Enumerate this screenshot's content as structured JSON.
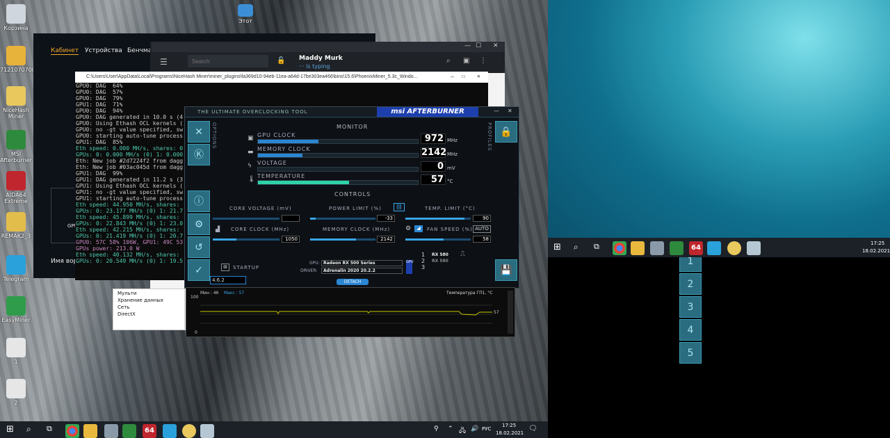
{
  "desktop": {
    "icons": [
      {
        "label": "Корзина",
        "color": "#cfd6dd"
      },
      {
        "label": "7121070700",
        "color": "#e8b33a"
      },
      {
        "label": "NiceHash Miner",
        "color": "#e9c95e"
      },
      {
        "label": "MSI Afterburner",
        "color": "#2e8a3c"
      },
      {
        "label": "AIDA64 Extreme",
        "color": "#c0262d"
      },
      {
        "label": "REMAK2_3",
        "color": "#e3bd4c"
      },
      {
        "label": "Telegram",
        "color": "#2aa1da"
      },
      {
        "label": "EasyMiner",
        "color": "#2f9c4b"
      },
      {
        "label": "1",
        "color": "#e6e6e6"
      },
      {
        "label": "2",
        "color": "#e6e6e6"
      }
    ],
    "this_pc": "Этот"
  },
  "nicehash": {
    "tabs": [
      "Кабинет",
      "Устройства",
      "Бенчмарк"
    ],
    "gpu_label": "GPU",
    "name_label": "Имя вор"
  },
  "telegram": {
    "search_placeholder": "Search",
    "contact": "Maddy Murk",
    "status": "··· is typing"
  },
  "cmd": {
    "title": "C:\\Users\\User\\AppData\\Local\\Programs\\NiceHash Miner\\miner_plugins\\fa369d10-94eb-11ea-a64d-17be303ea466\\bins\\15.6\\PhoenixMiner_5.3c_Windo...",
    "lines": [
      {
        "t": "GPU0: DAG  64%",
        "c": "#ccc"
      },
      {
        "t": "GPU0: DAG  57%",
        "c": "#ccc"
      },
      {
        "t": "GPU0: DAG  79%",
        "c": "#ccc"
      },
      {
        "t": "GPU1: DAG  71%",
        "c": "#ccc"
      },
      {
        "t": "GPU0: DAG  94%",
        "c": "#ccc"
      },
      {
        "t": "GPU0: DAG generated in 10.0 s (4",
        "c": "#ccc"
      },
      {
        "t": "GPU0: Using Ethash OCL kernels (",
        "c": "#ccc"
      },
      {
        "t": "GPU0: no -gt value specified, sw",
        "c": "#ccc"
      },
      {
        "t": "GPU0: starting auto-tune process",
        "c": "#ccc"
      },
      {
        "t": "GPU1: DAG  85%",
        "c": "#ccc"
      },
      {
        "t": "Eth speed: 0.000 MH/s, shares: 0",
        "c": "#4ec9b0"
      },
      {
        "t": "GPUs: 0: 0.000 MH/s (0) 1: 0.000",
        "c": "#4ec9b0"
      },
      {
        "t": "Eth: New job #2d7224f2 from dagg",
        "c": "#ccc"
      },
      {
        "t": "Eth: New job #03ac045d from dagg",
        "c": "#ccc"
      },
      {
        "t": "GPU1: DAG  99%",
        "c": "#ccc"
      },
      {
        "t": "GPU1: DAG generated in 11.2 s (3",
        "c": "#ccc"
      },
      {
        "t": "GPU1: Using Ethash OCL kernels (",
        "c": "#ccc"
      },
      {
        "t": "GPU1: no -gt value specified, sw",
        "c": "#ccc"
      },
      {
        "t": "GPU1: starting auto-tune process",
        "c": "#ccc"
      },
      {
        "t": "Eth speed: 44.950 MH/s, shares: ",
        "c": "#4ec9b0"
      },
      {
        "t": "GPUs: 0: 23.177 MH/s (0) 1: 21.7",
        "c": "#4ec9b0"
      },
      {
        "t": "Eth speed: 45.899 MH/s, shares: ",
        "c": "#4ec9b0"
      },
      {
        "t": "GPUs: 0: 22.843 MH/s (0) 1: 23.0",
        "c": "#4ec9b0"
      },
      {
        "t": "Eth speed: 42.215 MH/s, shares: ",
        "c": "#4ec9b0"
      },
      {
        "t": "GPUs: 0: 21.419 MH/s (0) 1: 20.7",
        "c": "#4ec9b0"
      },
      {
        "t": "GPU0: 57C 58% 106W, GPU1: 49C 53",
        "c": "#c586c0"
      },
      {
        "t": "GPUs power: 213.0 W",
        "c": "#c586c0"
      },
      {
        "t": "Eth speed: 40.132 MH/s, shares: ",
        "c": "#4ec9b0"
      },
      {
        "t": "GPUs: 0: 20.549 MH/s (0) 1: 19.5",
        "c": "#4ec9b0"
      }
    ]
  },
  "explorer": {
    "items": [
      "Мульти",
      "Хранение данных",
      "Сеть",
      "DirectX"
    ]
  },
  "afterburner": {
    "tagline": "THE ULTIMATE OVERCLOCKING TOOL",
    "brand": "msi AFTERBURNER",
    "options": "OPTIONS",
    "profiles": "PROFILES",
    "monitor_title": "MONITOR",
    "controls_title": "CONTROLS",
    "monitor": [
      {
        "label": "GPU CLOCK",
        "value": "972",
        "unit": "MHz",
        "fill_pct": 38,
        "color": "#2b86d3"
      },
      {
        "label": "MEMORY CLOCK",
        "value": "2142",
        "unit": "MHz",
        "fill_pct": 28,
        "color": "#2b86d3"
      },
      {
        "label": "VOLTAGE",
        "value": "0",
        "unit": "mV",
        "fill_pct": 0,
        "color": "#2b86d3"
      },
      {
        "label": "TEMPERATURE",
        "value": "57",
        "unit": "°C",
        "fill_pct": 57,
        "color": "#2ed3a8"
      }
    ],
    "core_voltage_label": "CORE VOLTAGE (mV)",
    "power_limit_label": "POWER LIMIT (%)",
    "power_limit_value": "-33",
    "power_limit_fill": 0.08,
    "temp_limit_label": "TEMP. LIMIT (°C)",
    "temp_limit_value": "90",
    "temp_limit_fill": 0.9,
    "core_clock_label": "CORE CLOCK (MHz)",
    "core_clock_value": "1050",
    "core_clock_fill": 0.35,
    "memory_clock_label": "MEMORY CLOCK (MHz)",
    "memory_clock_value": "2142",
    "memory_clock_fill": 0.7,
    "fan_speed_label": "FAN SPEED (%)",
    "fan_auto": "AUTO",
    "fan_speed_value": "58",
    "fan_fill": 0.58,
    "startup": "STARTUP",
    "gpu_label": "GPU:",
    "gpu_value": "Radeon RX 500 Series",
    "driver_label": "DRIVER:",
    "driver_value": "Adrenalin 2020 20.2.2",
    "gpu_list": [
      {
        "n": "1",
        "name": "RX 580"
      },
      {
        "n": "2",
        "name": "RX 580"
      },
      {
        "n": "3",
        "name": ""
      }
    ],
    "version": "4.6.2",
    "detach": "DETACH",
    "profile_slots": [
      "1",
      "2",
      "3",
      "4",
      "5"
    ],
    "graph": {
      "min_label": "Мин : 46",
      "max_label": "Макс : 57",
      "title": "Температура ГП1, °C",
      "ymax": "100",
      "ymin": "0",
      "current": "57"
    }
  },
  "taskbar": {
    "time": "17:25",
    "date": "18.02.2021",
    "lang": "РУС"
  },
  "taskbar2": {
    "time": "17:25",
    "date": "18.02.2021"
  }
}
